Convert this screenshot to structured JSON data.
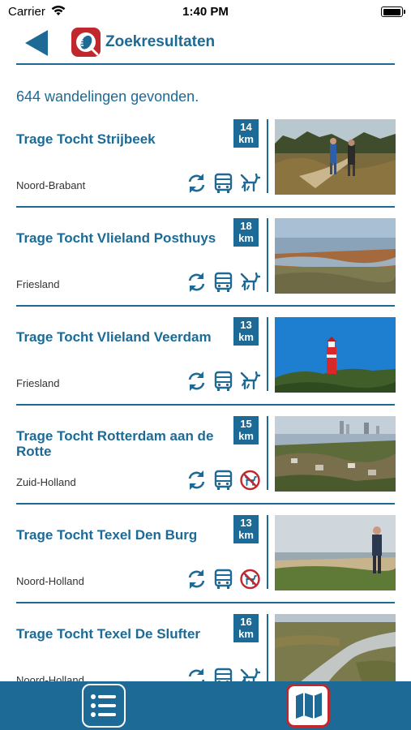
{
  "status_bar": {
    "carrier": "Carrier",
    "time": "1:40 PM",
    "battery_level": 0.95
  },
  "header": {
    "title": "Zoekresultaten",
    "back_icon": "back-arrow-icon",
    "logo_icon": "walking-shoe-logo-icon"
  },
  "results_count_text": "644 wandelingen gevonden.",
  "colors": {
    "primary": "#1d6a96",
    "accent_red": "#c0282e",
    "background": "#ffffff"
  },
  "results": [
    {
      "title": "Trage Tocht Strijbeek",
      "region": "Noord-Brabant",
      "km": "14",
      "unit": "km",
      "icons": [
        "loop-icon",
        "bus-icon",
        "dog-allowed-icon"
      ],
      "photo": "heath-with-hikers"
    },
    {
      "title": "Trage Tocht Vlieland Posthuys",
      "region": "Friesland",
      "km": "18",
      "unit": "km",
      "icons": [
        "loop-icon",
        "bus-icon",
        "dog-allowed-icon"
      ],
      "photo": "wadden-coast"
    },
    {
      "title": "Trage Tocht Vlieland Veerdam",
      "region": "Friesland",
      "km": "13",
      "unit": "km",
      "icons": [
        "loop-icon",
        "bus-icon",
        "dog-allowed-icon"
      ],
      "photo": "red-lighthouse"
    },
    {
      "title": "Trage Tocht Rotterdam aan de Rotte",
      "region": "Zuid-Holland",
      "km": "15",
      "unit": "km",
      "icons": [
        "loop-icon",
        "bus-icon",
        "no-dogs-icon"
      ],
      "photo": "city-skyline-river"
    },
    {
      "title": "Trage Tocht Texel Den Burg",
      "region": "Noord-Holland",
      "km": "13",
      "unit": "km",
      "icons": [
        "loop-icon",
        "bus-icon",
        "no-dogs-icon"
      ],
      "photo": "beach-with-walker"
    },
    {
      "title": "Trage Tocht Texel De Slufter",
      "region": "Noord-Holland",
      "km": "16",
      "unit": "km",
      "icons": [
        "loop-icon",
        "bus-icon",
        "dog-allowed-icon"
      ],
      "photo": "salt-marsh-creek"
    }
  ],
  "tabbar": {
    "list_icon": "list-icon",
    "map_icon": "map-icon",
    "active_tab": "map"
  }
}
